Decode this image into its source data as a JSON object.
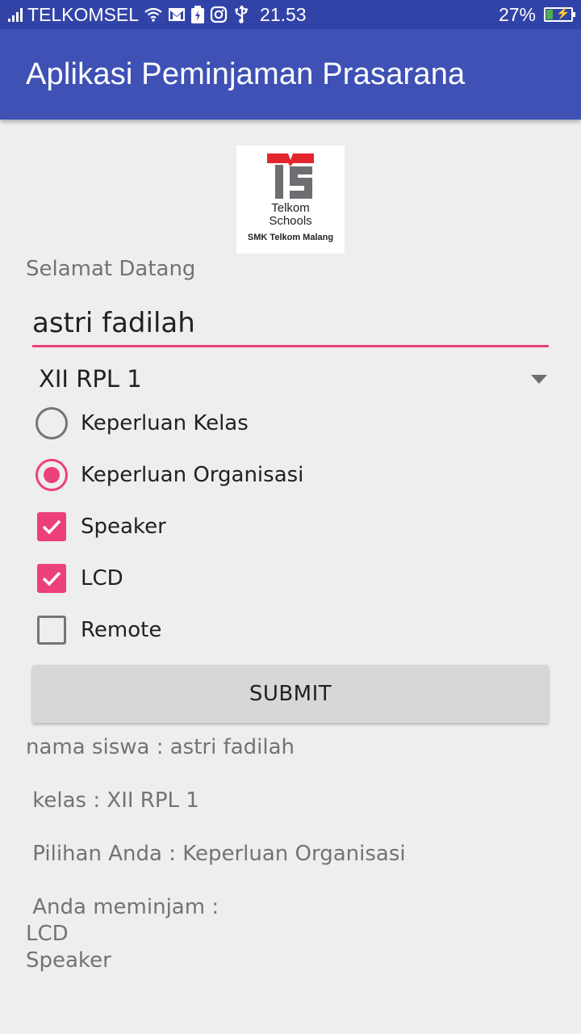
{
  "status_bar": {
    "carrier": "TELKOMSEL",
    "time": "21.53",
    "battery": "27%",
    "battery_level": 0.27,
    "icons": [
      "signal-icon",
      "wifi-icon",
      "gmail-icon",
      "battery-saver-icon",
      "instagram-icon",
      "usb-icon"
    ]
  },
  "toolbar": {
    "title": "Aplikasi Peminjaman Prasarana"
  },
  "logo": {
    "line1": "Telkom",
    "line2": "Schools",
    "line3": "SMK Telkom Malang",
    "colors": {
      "red": "#e3262e",
      "gray": "#6d6e71"
    }
  },
  "form": {
    "welcome": "Selamat Datang",
    "name_value": "astri fadilah",
    "class_selected": "XII RPL 1",
    "radios": [
      {
        "label": "Keperluan Kelas",
        "checked": false
      },
      {
        "label": "Keperluan Organisasi",
        "checked": true
      }
    ],
    "checkboxes": [
      {
        "label": "Speaker",
        "checked": true
      },
      {
        "label": "LCD",
        "checked": true
      },
      {
        "label": "Remote",
        "checked": false
      }
    ],
    "submit_label": "SUBMIT"
  },
  "result": {
    "nama": "nama siswa : astri fadilah",
    "kelas": " kelas : XII RPL 1",
    "pilihan": " Pilihan Anda : Keperluan Organisasi",
    "meminjam": " Anda meminjam :",
    "items": [
      "LCD",
      "Speaker"
    ]
  },
  "colors": {
    "primary": "#3f51b5",
    "primary_dark": "#3243a8",
    "accent": "#ec407a",
    "background": "#eeeeee"
  }
}
